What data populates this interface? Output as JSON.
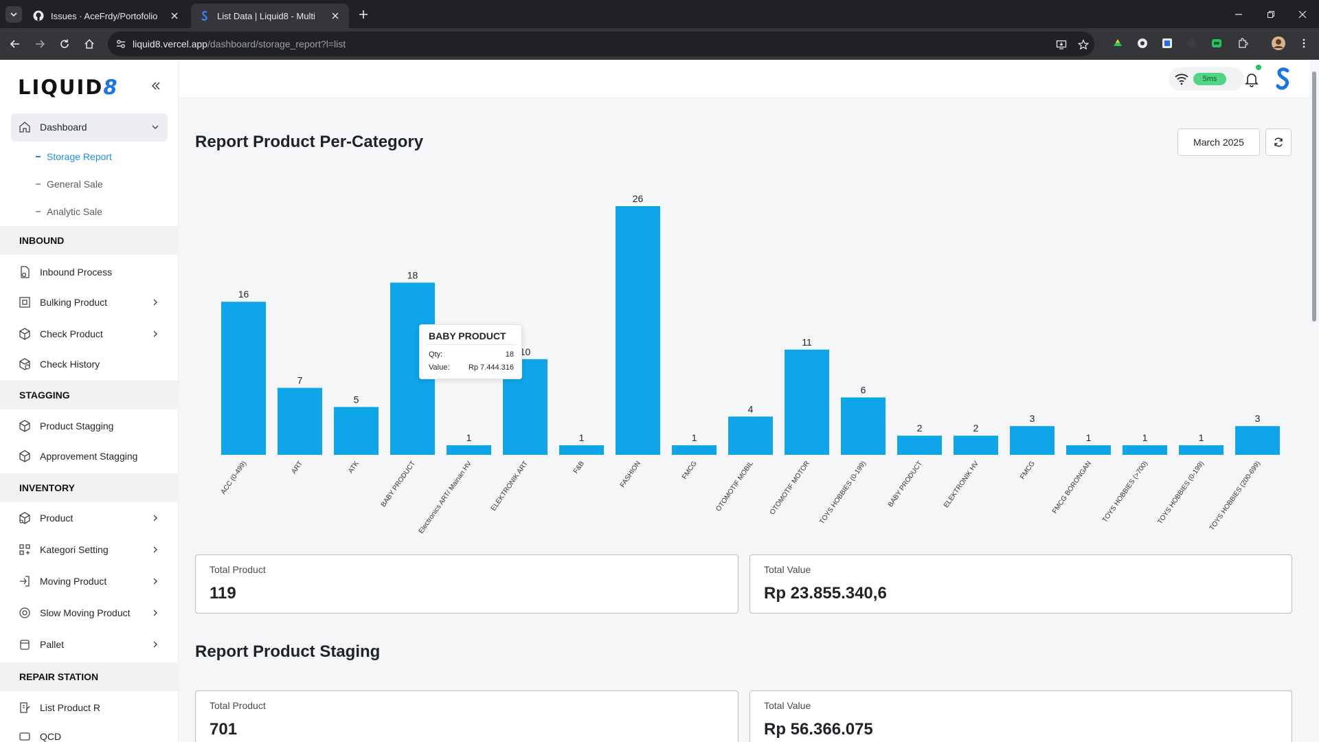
{
  "browser": {
    "tabs": [
      {
        "title": "Issues · AceFrdy/Portofolio"
      },
      {
        "title": "List Data | Liquid8 - Multi"
      }
    ],
    "url_host": "liquid8.vercel.app",
    "url_path": "/dashboard/storage_report?l=list"
  },
  "app": {
    "logo_text": "LIQUID",
    "logo_mark": "8"
  },
  "sidebar": {
    "dashboard_label": "Dashboard",
    "sub_items": [
      "Storage Report",
      "General Sale",
      "Analytic Sale"
    ],
    "sections": {
      "inbound": "INBOUND",
      "stagging": "STAGGING",
      "inventory": "INVENTORY",
      "repair": "REPAIR STATION"
    },
    "inbound_items": [
      "Inbound Process",
      "Bulking Product",
      "Check Product",
      "Check History"
    ],
    "stagging_items": [
      "Product Stagging",
      "Approvement Stagging"
    ],
    "inventory_items": [
      "Product",
      "Kategori Setting",
      "Moving Product",
      "Slow Moving Product",
      "Pallet"
    ],
    "repair_items": [
      "List Product R",
      "QCD"
    ]
  },
  "topbar": {
    "ping": "5ms"
  },
  "report": {
    "title": "Report Product Per-Category",
    "month": "March 2025",
    "tooltip": {
      "title": "BABY PRODUCT",
      "qty_label": "Qty:",
      "qty_value": "18",
      "value_label": "Value:",
      "value_value": "Rp 7.444.316"
    },
    "total_product_label": "Total Product",
    "total_product": "119",
    "total_value_label": "Total Value",
    "total_value": "Rp 23.855.340,6"
  },
  "staging": {
    "title": "Report Product Staging",
    "total_product_label": "Total Product",
    "total_product": "701",
    "total_value_label": "Total Value",
    "total_value": "Rp 56.366.075"
  },
  "chart_data": {
    "type": "bar",
    "title": "Report Product Per-Category",
    "categories": [
      "ACC (0-499)",
      "ART",
      "ATK",
      "BABY PRODUCT",
      "Electronics ART/ Mainan HV",
      "ELEKTRONIK ART",
      "F&B",
      "FASHION",
      "FMCG",
      "OTOMOTIF MOBIL",
      "OTOMOTIF MOTOR",
      "TOYS HOBBIES (0-199)",
      "BABY PRODUCT",
      "ELEKTRONIK HV",
      "FMCG",
      "FMCG BORONGAN",
      "TOYS HOBBIES (>700)",
      "TOYS HOBBIES (0-199)",
      "TOYS HOBBIES (200-699)"
    ],
    "values": [
      16,
      7,
      5,
      18,
      1,
      10,
      1,
      26,
      1,
      4,
      11,
      6,
      2,
      2,
      3,
      1,
      1,
      1,
      3
    ],
    "ylim": [
      0,
      26
    ],
    "bar_color": "#0ea5e9",
    "grid": false
  },
  "colors": {
    "accent": "#1b8fe8",
    "bar": "#0ea5e9",
    "ping_bg": "#51d483"
  }
}
